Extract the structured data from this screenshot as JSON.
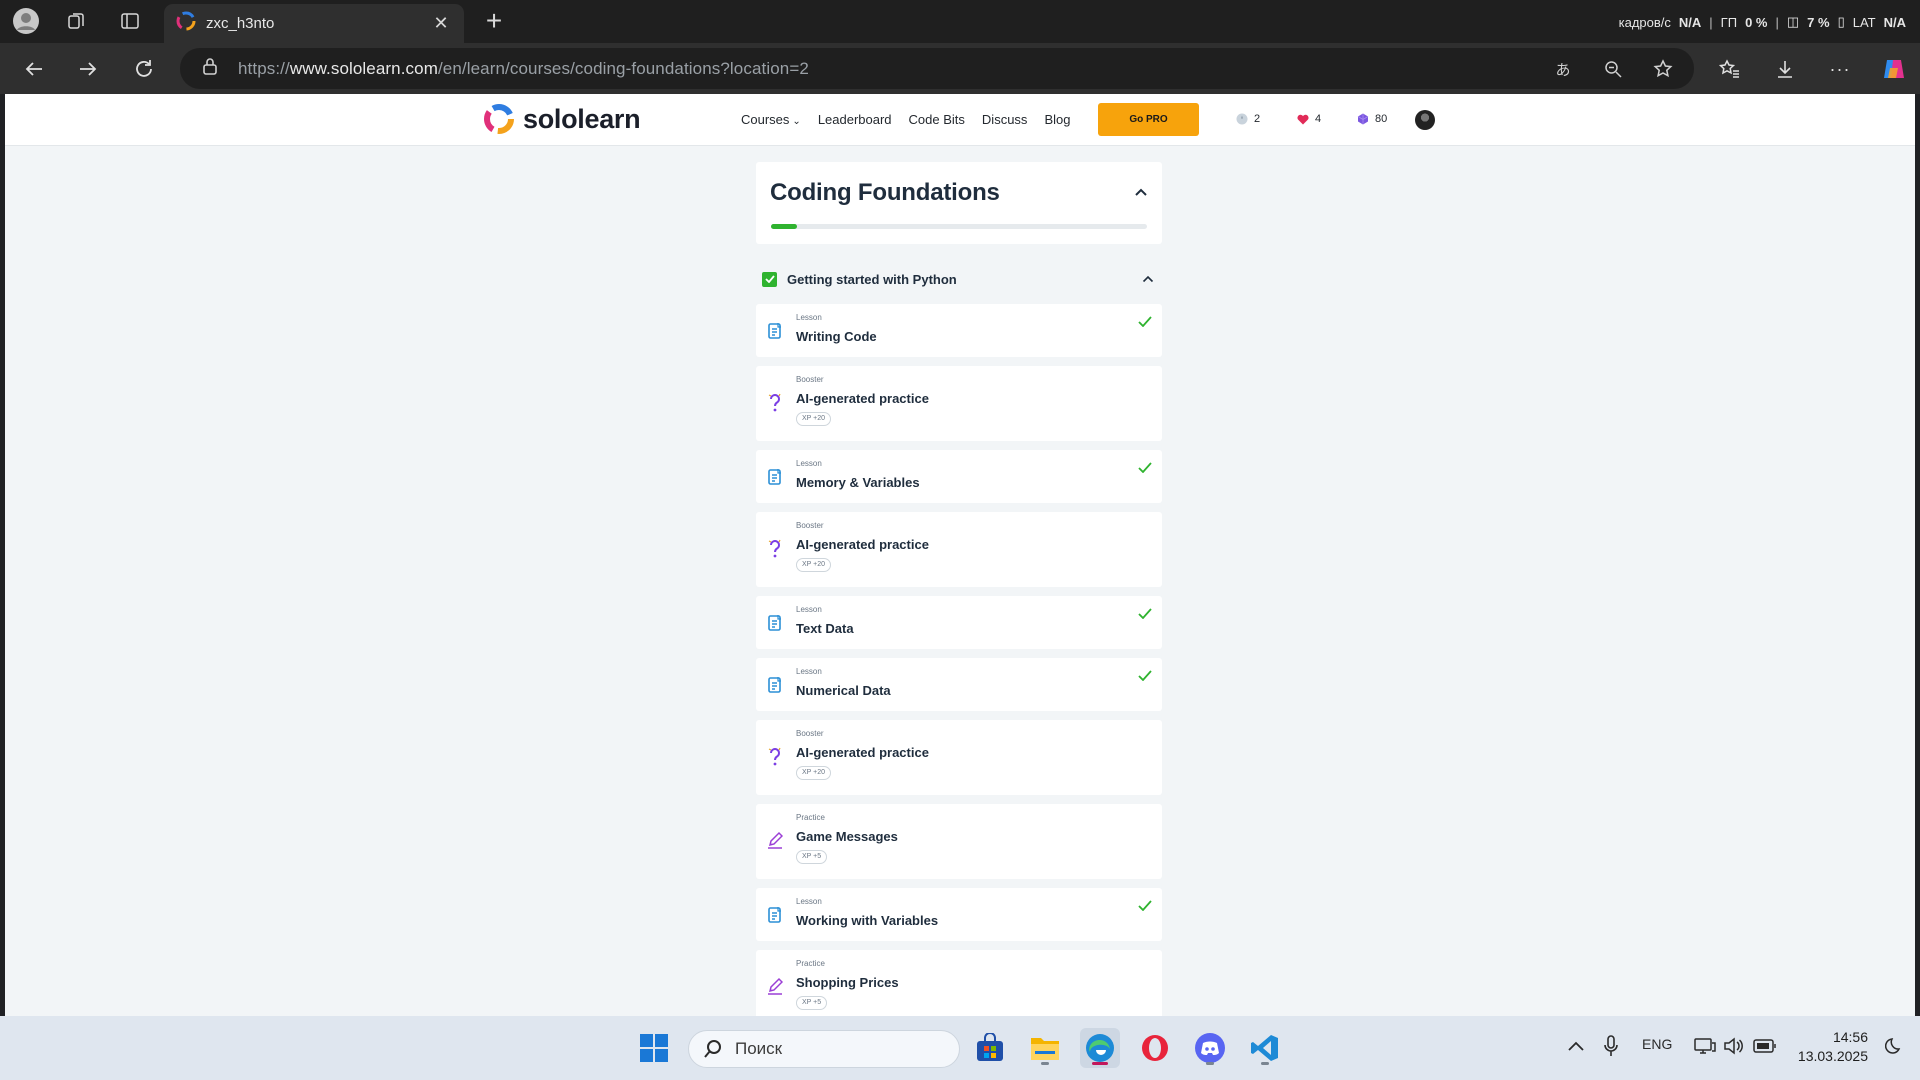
{
  "browser": {
    "tab_title": "zxc_h3nto",
    "url_prefix": "https://",
    "url_host": "www.sololearn.com",
    "url_path": "/en/learn/courses/coding-foundations?location=2",
    "perf": {
      "fps_label": "кадров/с",
      "fps_value": "N/A",
      "gpu_label": "ГП",
      "gpu_value": "0 %",
      "cpu_value": "7 %",
      "lang": "LAT",
      "extra_value": "N/A"
    }
  },
  "site": {
    "logo_text": "sololearn",
    "nav": {
      "courses": "Courses",
      "leaderboard": "Leaderboard",
      "code_bits": "Code Bits",
      "discuss": "Discuss",
      "blog": "Blog"
    },
    "go_pro": "Go PRO",
    "stats": {
      "streak": "2",
      "hearts": "4",
      "gems": "80"
    }
  },
  "course": {
    "title": "Coding Foundations",
    "progress_fraction": 0.07,
    "module_title": "Getting started with Python",
    "items": [
      {
        "type": "Lesson",
        "title": "Writing Code",
        "completed": true,
        "icon": "lesson-icon"
      },
      {
        "type": "Booster",
        "title": "AI-generated practice",
        "xp": "XP +20",
        "completed": false,
        "icon": "question-icon"
      },
      {
        "type": "Lesson",
        "title": "Memory & Variables",
        "completed": true,
        "icon": "lesson-icon"
      },
      {
        "type": "Booster",
        "title": "AI-generated practice",
        "xp": "XP +20",
        "completed": false,
        "icon": "question-icon"
      },
      {
        "type": "Lesson",
        "title": "Text Data",
        "completed": true,
        "icon": "lesson-icon"
      },
      {
        "type": "Lesson",
        "title": "Numerical Data",
        "completed": true,
        "icon": "lesson-icon"
      },
      {
        "type": "Booster",
        "title": "AI-generated practice",
        "xp": "XP +20",
        "completed": false,
        "icon": "question-icon"
      },
      {
        "type": "Practice",
        "title": "Game Messages",
        "xp": "XP +5",
        "completed": false,
        "icon": "pencil-icon"
      },
      {
        "type": "Lesson",
        "title": "Working with Variables",
        "completed": true,
        "icon": "lesson-icon"
      },
      {
        "type": "Practice",
        "title": "Shopping Prices",
        "xp": "XP +5",
        "completed": false,
        "icon": "pencil-icon"
      }
    ]
  },
  "taskbar": {
    "search_placeholder": "Поиск",
    "lang": "ENG",
    "time": "14:56",
    "date": "13.03.2025"
  },
  "colors": {
    "accent_green": "#2fb32f",
    "go_pro": "#f7a30c",
    "lesson_blue": "#2b8fd6",
    "booster_purple": "#7b3fe4"
  }
}
